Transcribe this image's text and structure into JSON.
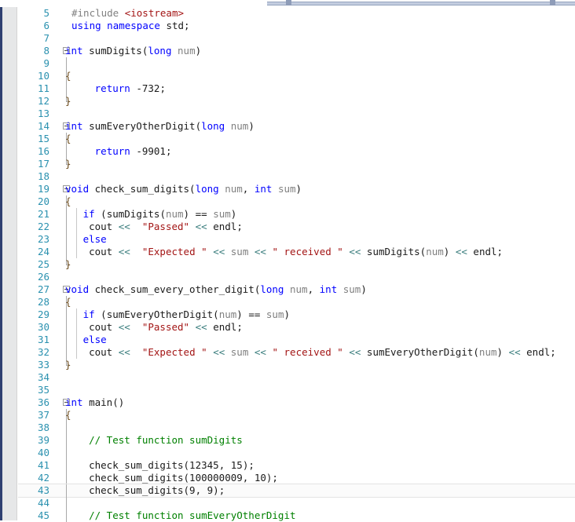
{
  "app": {
    "type": "code-editor",
    "language": "C++",
    "current_line": 43
  },
  "splitter": {
    "name": "horizontal-splitter"
  },
  "colors": {
    "keyword": "#0000ff",
    "string": "#a31515",
    "comment": "#008000",
    "line_number": "#2b91af",
    "operator": "#3a7d7d",
    "parameter": "#808080",
    "preprocessor": "#808080",
    "brace": "#6b4a1a",
    "indicator_margin": "#2f4071",
    "track_strip": "#e6e7e8",
    "splitter_bar": "#c3cddf",
    "background": "#ffffff"
  },
  "lines": [
    {
      "n": "5",
      "indent": 20,
      "fold": "none",
      "guide": null,
      "tokens": [
        {
          "t": "#include ",
          "c": "pp"
        },
        {
          "t": "<iostream>",
          "c": "str"
        }
      ]
    },
    {
      "n": "6",
      "indent": 20,
      "fold": "none",
      "guide": null,
      "tokens": [
        {
          "t": "using",
          "c": "kw"
        },
        {
          "t": " ",
          "c": "punc"
        },
        {
          "t": "namespace",
          "c": "kw"
        },
        {
          "t": " ",
          "c": "punc"
        },
        {
          "t": "std",
          "c": "id"
        },
        {
          "t": ";",
          "c": "punc"
        }
      ]
    },
    {
      "n": "7",
      "indent": 20,
      "fold": "none",
      "guide": null,
      "tokens": []
    },
    {
      "n": "8",
      "indent": 12,
      "fold": "box",
      "guide": null,
      "tokens": [
        {
          "t": "int",
          "c": "kw"
        },
        {
          "t": " sumDigits",
          "c": "id"
        },
        {
          "t": "(",
          "c": "punc"
        },
        {
          "t": "long",
          "c": "kw"
        },
        {
          "t": " ",
          "c": "punc"
        },
        {
          "t": "num",
          "c": "param"
        },
        {
          "t": ")",
          "c": "punc"
        }
      ]
    },
    {
      "n": "9",
      "indent": 12,
      "fold": "line",
      "guide": null,
      "tokens": []
    },
    {
      "n": "10",
      "indent": 12,
      "fold": "line",
      "guide": null,
      "tokens": [
        {
          "t": "{",
          "c": "brace"
        }
      ]
    },
    {
      "n": "11",
      "indent": 12,
      "fold": "line",
      "guide": null,
      "tokens": [
        {
          "t": "     ",
          "c": "punc"
        },
        {
          "t": "return",
          "c": "kw"
        },
        {
          "t": " -",
          "c": "punc"
        },
        {
          "t": "732",
          "c": "num"
        },
        {
          "t": ";",
          "c": "punc"
        }
      ]
    },
    {
      "n": "12",
      "indent": 12,
      "fold": "end",
      "guide": null,
      "tokens": [
        {
          "t": "}",
          "c": "brace"
        }
      ]
    },
    {
      "n": "13",
      "indent": 20,
      "fold": "none",
      "guide": null,
      "tokens": []
    },
    {
      "n": "14",
      "indent": 12,
      "fold": "box",
      "guide": null,
      "tokens": [
        {
          "t": "int",
          "c": "kw"
        },
        {
          "t": " sumEveryOtherDigit",
          "c": "id"
        },
        {
          "t": "(",
          "c": "punc"
        },
        {
          "t": "long",
          "c": "kw"
        },
        {
          "t": " ",
          "c": "punc"
        },
        {
          "t": "num",
          "c": "param"
        },
        {
          "t": ")",
          "c": "punc"
        }
      ]
    },
    {
      "n": "15",
      "indent": 12,
      "fold": "line",
      "guide": null,
      "tokens": [
        {
          "t": "{",
          "c": "brace"
        }
      ]
    },
    {
      "n": "16",
      "indent": 12,
      "fold": "line",
      "guide": null,
      "tokens": [
        {
          "t": "     ",
          "c": "punc"
        },
        {
          "t": "return",
          "c": "kw"
        },
        {
          "t": " -",
          "c": "punc"
        },
        {
          "t": "9901",
          "c": "num"
        },
        {
          "t": ";",
          "c": "punc"
        }
      ]
    },
    {
      "n": "17",
      "indent": 12,
      "fold": "end",
      "guide": null,
      "tokens": [
        {
          "t": "}",
          "c": "brace"
        }
      ]
    },
    {
      "n": "18",
      "indent": 20,
      "fold": "none",
      "guide": null,
      "tokens": []
    },
    {
      "n": "19",
      "indent": 12,
      "fold": "box",
      "guide": null,
      "tokens": [
        {
          "t": "void",
          "c": "kw"
        },
        {
          "t": " check_sum_digits",
          "c": "id"
        },
        {
          "t": "(",
          "c": "punc"
        },
        {
          "t": "long",
          "c": "kw"
        },
        {
          "t": " ",
          "c": "punc"
        },
        {
          "t": "num",
          "c": "param"
        },
        {
          "t": ", ",
          "c": "punc"
        },
        {
          "t": "int",
          "c": "kw"
        },
        {
          "t": " ",
          "c": "punc"
        },
        {
          "t": "sum",
          "c": "param"
        },
        {
          "t": ")",
          "c": "punc"
        }
      ]
    },
    {
      "n": "20",
      "indent": 12,
      "fold": "line",
      "guide": null,
      "tokens": [
        {
          "t": "{",
          "c": "brace"
        }
      ]
    },
    {
      "n": "21",
      "indent": 12,
      "fold": "line",
      "guide": 14,
      "tokens": [
        {
          "t": "   ",
          "c": "punc"
        },
        {
          "t": "if",
          "c": "kw"
        },
        {
          "t": " (sumDigits",
          "c": "id"
        },
        {
          "t": "(",
          "c": "punc"
        },
        {
          "t": "num",
          "c": "param"
        },
        {
          "t": ") == ",
          "c": "punc"
        },
        {
          "t": "sum",
          "c": "param"
        },
        {
          "t": ")",
          "c": "punc"
        }
      ]
    },
    {
      "n": "22",
      "indent": 12,
      "fold": "line",
      "guide": 14,
      "tokens": [
        {
          "t": "    cout ",
          "c": "id"
        },
        {
          "t": "<<",
          "c": "op"
        },
        {
          "t": "  ",
          "c": "punc"
        },
        {
          "t": "\"Passed\"",
          "c": "str"
        },
        {
          "t": " ",
          "c": "punc"
        },
        {
          "t": "<<",
          "c": "op"
        },
        {
          "t": " endl",
          "c": "id"
        },
        {
          "t": ";",
          "c": "punc"
        }
      ]
    },
    {
      "n": "23",
      "indent": 12,
      "fold": "line",
      "guide": 14,
      "tokens": [
        {
          "t": "   ",
          "c": "punc"
        },
        {
          "t": "else",
          "c": "kw"
        }
      ]
    },
    {
      "n": "24",
      "indent": 12,
      "fold": "line",
      "guide": 14,
      "tokens": [
        {
          "t": "    cout ",
          "c": "id"
        },
        {
          "t": "<<",
          "c": "op"
        },
        {
          "t": "  ",
          "c": "punc"
        },
        {
          "t": "\"Expected \"",
          "c": "str"
        },
        {
          "t": " ",
          "c": "punc"
        },
        {
          "t": "<<",
          "c": "op"
        },
        {
          "t": " ",
          "c": "punc"
        },
        {
          "t": "sum",
          "c": "param"
        },
        {
          "t": " ",
          "c": "punc"
        },
        {
          "t": "<<",
          "c": "op"
        },
        {
          "t": " ",
          "c": "punc"
        },
        {
          "t": "\" received \"",
          "c": "str"
        },
        {
          "t": " ",
          "c": "punc"
        },
        {
          "t": "<<",
          "c": "op"
        },
        {
          "t": " sumDigits",
          "c": "id"
        },
        {
          "t": "(",
          "c": "punc"
        },
        {
          "t": "num",
          "c": "param"
        },
        {
          "t": ") ",
          "c": "punc"
        },
        {
          "t": "<<",
          "c": "op"
        },
        {
          "t": " endl",
          "c": "id"
        },
        {
          "t": ";",
          "c": "punc"
        }
      ]
    },
    {
      "n": "25",
      "indent": 12,
      "fold": "end",
      "guide": null,
      "tokens": [
        {
          "t": "}",
          "c": "brace"
        }
      ]
    },
    {
      "n": "26",
      "indent": 20,
      "fold": "none",
      "guide": null,
      "tokens": []
    },
    {
      "n": "27",
      "indent": 12,
      "fold": "box",
      "guide": null,
      "tokens": [
        {
          "t": "void",
          "c": "kw"
        },
        {
          "t": " check_sum_every_other_digit",
          "c": "id"
        },
        {
          "t": "(",
          "c": "punc"
        },
        {
          "t": "long",
          "c": "kw"
        },
        {
          "t": " ",
          "c": "punc"
        },
        {
          "t": "num",
          "c": "param"
        },
        {
          "t": ", ",
          "c": "punc"
        },
        {
          "t": "int",
          "c": "kw"
        },
        {
          "t": " ",
          "c": "punc"
        },
        {
          "t": "sum",
          "c": "param"
        },
        {
          "t": ")",
          "c": "punc"
        }
      ]
    },
    {
      "n": "28",
      "indent": 12,
      "fold": "line",
      "guide": null,
      "tokens": [
        {
          "t": "{",
          "c": "brace"
        }
      ]
    },
    {
      "n": "29",
      "indent": 12,
      "fold": "line",
      "guide": 14,
      "tokens": [
        {
          "t": "   ",
          "c": "punc"
        },
        {
          "t": "if",
          "c": "kw"
        },
        {
          "t": " (sumEveryOtherDigit",
          "c": "id"
        },
        {
          "t": "(",
          "c": "punc"
        },
        {
          "t": "num",
          "c": "param"
        },
        {
          "t": ") == ",
          "c": "punc"
        },
        {
          "t": "sum",
          "c": "param"
        },
        {
          "t": ")",
          "c": "punc"
        }
      ]
    },
    {
      "n": "30",
      "indent": 12,
      "fold": "line",
      "guide": 14,
      "tokens": [
        {
          "t": "    cout ",
          "c": "id"
        },
        {
          "t": "<<",
          "c": "op"
        },
        {
          "t": "  ",
          "c": "punc"
        },
        {
          "t": "\"Passed\"",
          "c": "str"
        },
        {
          "t": " ",
          "c": "punc"
        },
        {
          "t": "<<",
          "c": "op"
        },
        {
          "t": " endl",
          "c": "id"
        },
        {
          "t": ";",
          "c": "punc"
        }
      ]
    },
    {
      "n": "31",
      "indent": 12,
      "fold": "line",
      "guide": 14,
      "tokens": [
        {
          "t": "   ",
          "c": "punc"
        },
        {
          "t": "else",
          "c": "kw"
        }
      ]
    },
    {
      "n": "32",
      "indent": 12,
      "fold": "line",
      "guide": 14,
      "tokens": [
        {
          "t": "    cout ",
          "c": "id"
        },
        {
          "t": "<<",
          "c": "op"
        },
        {
          "t": "  ",
          "c": "punc"
        },
        {
          "t": "\"Expected \"",
          "c": "str"
        },
        {
          "t": " ",
          "c": "punc"
        },
        {
          "t": "<<",
          "c": "op"
        },
        {
          "t": " ",
          "c": "punc"
        },
        {
          "t": "sum",
          "c": "param"
        },
        {
          "t": " ",
          "c": "punc"
        },
        {
          "t": "<<",
          "c": "op"
        },
        {
          "t": " ",
          "c": "punc"
        },
        {
          "t": "\" received \"",
          "c": "str"
        },
        {
          "t": " ",
          "c": "punc"
        },
        {
          "t": "<<",
          "c": "op"
        },
        {
          "t": " sumEveryOtherDigit",
          "c": "id"
        },
        {
          "t": "(",
          "c": "punc"
        },
        {
          "t": "num",
          "c": "param"
        },
        {
          "t": ") ",
          "c": "punc"
        },
        {
          "t": "<<",
          "c": "op"
        },
        {
          "t": " endl",
          "c": "id"
        },
        {
          "t": ";",
          "c": "punc"
        }
      ]
    },
    {
      "n": "33",
      "indent": 12,
      "fold": "end",
      "guide": null,
      "tokens": [
        {
          "t": "}",
          "c": "brace"
        }
      ]
    },
    {
      "n": "34",
      "indent": 20,
      "fold": "none",
      "guide": null,
      "tokens": []
    },
    {
      "n": "35",
      "indent": 20,
      "fold": "none",
      "guide": null,
      "tokens": []
    },
    {
      "n": "36",
      "indent": 12,
      "fold": "box",
      "guide": null,
      "tokens": [
        {
          "t": "int",
          "c": "kw"
        },
        {
          "t": " main",
          "c": "id"
        },
        {
          "t": "()",
          "c": "punc"
        }
      ]
    },
    {
      "n": "37",
      "indent": 12,
      "fold": "line",
      "guide": null,
      "tokens": [
        {
          "t": "{",
          "c": "brace"
        }
      ]
    },
    {
      "n": "38",
      "indent": 12,
      "fold": "line",
      "guide": null,
      "tokens": []
    },
    {
      "n": "39",
      "indent": 12,
      "fold": "line",
      "guide": null,
      "tokens": [
        {
          "t": "    ",
          "c": "punc"
        },
        {
          "t": "// Test function sumDigits",
          "c": "cmt"
        }
      ]
    },
    {
      "n": "40",
      "indent": 12,
      "fold": "line",
      "guide": null,
      "tokens": []
    },
    {
      "n": "41",
      "indent": 12,
      "fold": "line",
      "guide": null,
      "tokens": [
        {
          "t": "    check_sum_digits",
          "c": "id"
        },
        {
          "t": "(",
          "c": "punc"
        },
        {
          "t": "12345",
          "c": "num"
        },
        {
          "t": ", ",
          "c": "punc"
        },
        {
          "t": "15",
          "c": "num"
        },
        {
          "t": ");",
          "c": "punc"
        }
      ]
    },
    {
      "n": "42",
      "indent": 12,
      "fold": "line",
      "guide": null,
      "tokens": [
        {
          "t": "    check_sum_digits",
          "c": "id"
        },
        {
          "t": "(",
          "c": "punc"
        },
        {
          "t": "100000009",
          "c": "num"
        },
        {
          "t": ", ",
          "c": "punc"
        },
        {
          "t": "10",
          "c": "num"
        },
        {
          "t": ");",
          "c": "punc"
        }
      ]
    },
    {
      "n": "43",
      "indent": 12,
      "fold": "line",
      "guide": null,
      "current": true,
      "tokens": [
        {
          "t": "    check_sum_digits",
          "c": "id"
        },
        {
          "t": "(",
          "c": "punc"
        },
        {
          "t": "9",
          "c": "num"
        },
        {
          "t": ", ",
          "c": "punc"
        },
        {
          "t": "9",
          "c": "num"
        },
        {
          "t": ");",
          "c": "punc"
        }
      ]
    },
    {
      "n": "44",
      "indent": 12,
      "fold": "line",
      "guide": null,
      "tokens": []
    },
    {
      "n": "45",
      "indent": 12,
      "fold": "line",
      "guide": null,
      "tokens": [
        {
          "t": "    ",
          "c": "punc"
        },
        {
          "t": "// Test function sumEveryOtherDigit",
          "c": "cmt"
        }
      ]
    }
  ]
}
